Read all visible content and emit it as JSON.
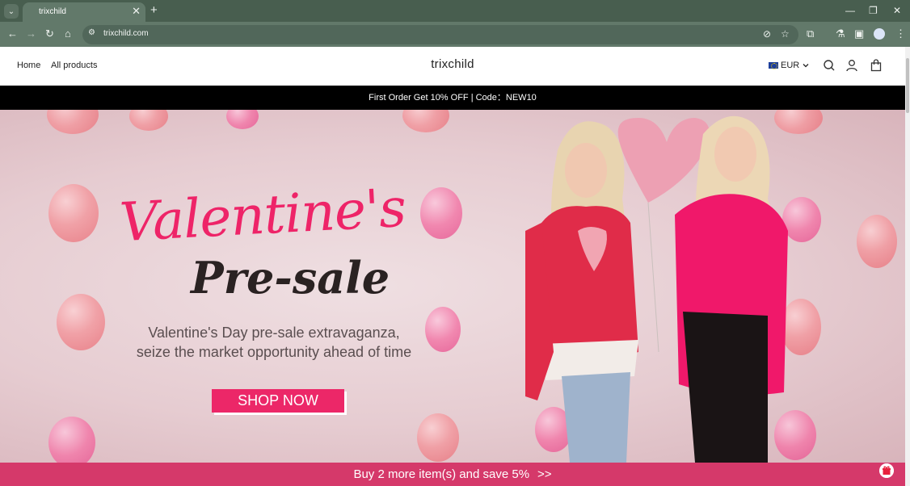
{
  "browser": {
    "tab_title": "trixchild",
    "url": "trixchild.com"
  },
  "store": {
    "nav": [
      "Home",
      "All products"
    ],
    "brand": "trixchild",
    "currency": "EUR"
  },
  "announcement": "First Order Get 10% OFF | Code：NEW10",
  "hero": {
    "title_line1": "Valentine's",
    "title_line2": "Pre-sale",
    "subtitle_line1": "Valentine's Day pre-sale extravaganza,",
    "subtitle_line2": "seize the market opportunity ahead of time",
    "cta": "SHOP NOW"
  },
  "promo": {
    "text": "Buy 2 more item(s) and save 5%",
    "arrow": ">>"
  },
  "colors": {
    "chrome_dark": "#485e4f",
    "chrome_light": "#62796a",
    "accent_pink": "#ec2768",
    "promo_bar": "#d5396a"
  }
}
